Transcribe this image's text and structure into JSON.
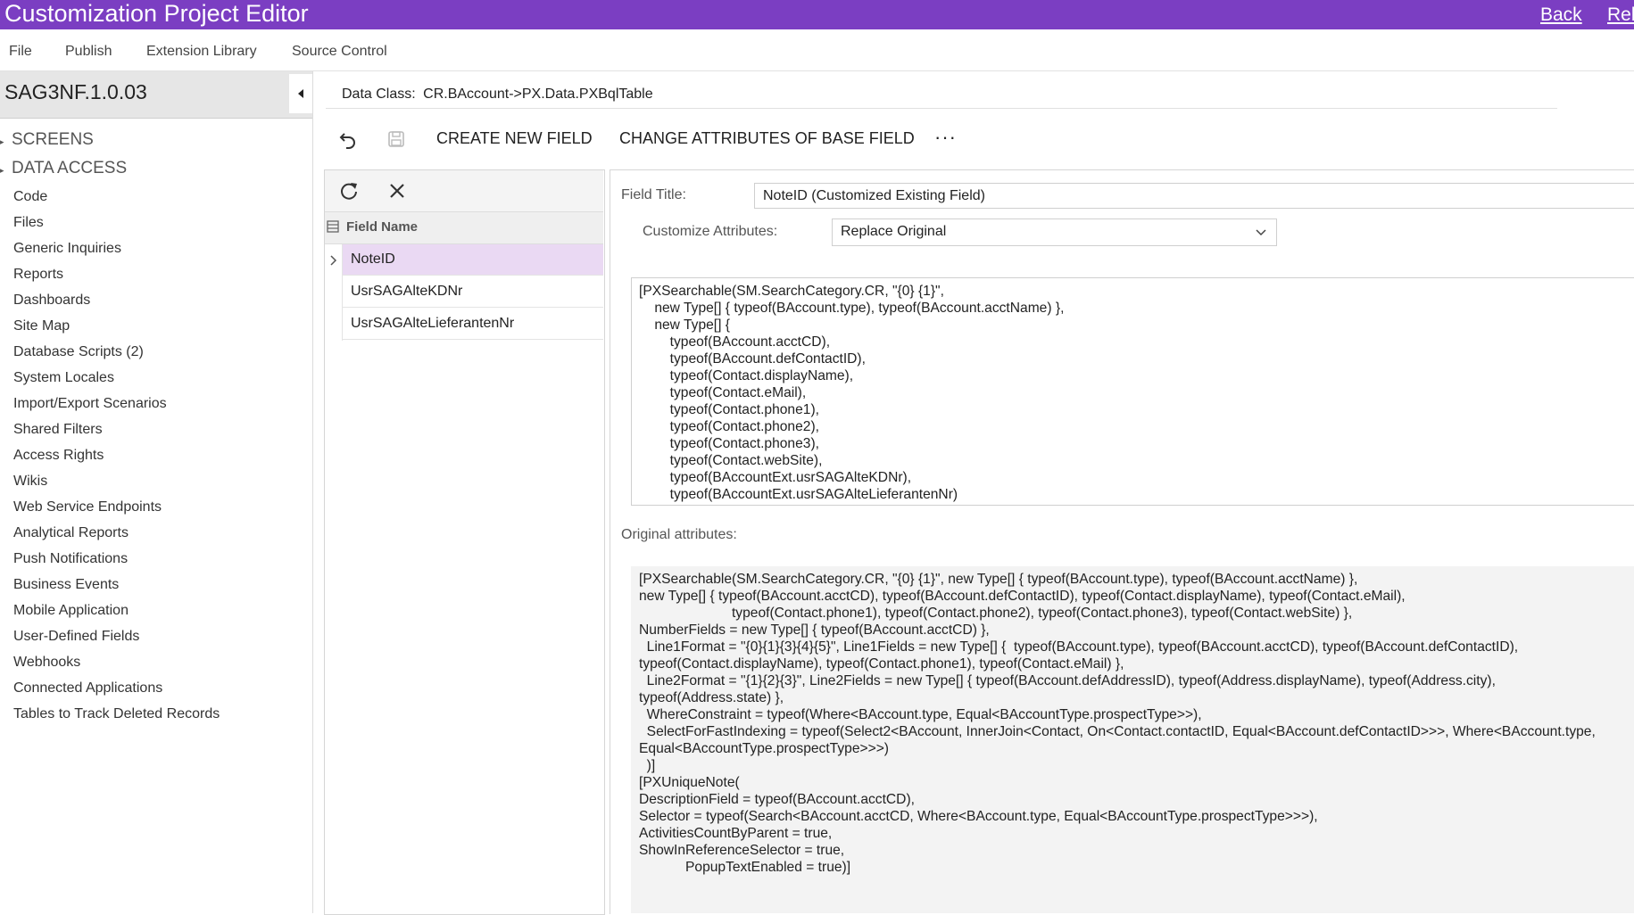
{
  "colors": {
    "accent": "#7b3ec2",
    "selected_row": "#ead9f3"
  },
  "header": {
    "title": "Customization Project Editor",
    "back_link": "Back",
    "right_link_partial": "Rel"
  },
  "menu": [
    "File",
    "Publish",
    "Extension Library",
    "Source Control"
  ],
  "sidebar": {
    "project_name": "SAG3NF.1.0.03",
    "groups": [
      "SCREENS",
      "DATA ACCESS"
    ],
    "items": [
      "Code",
      "Files",
      "Generic Inquiries",
      "Reports",
      "Dashboards",
      "Site Map",
      "Database Scripts (2)",
      "System Locales",
      "Import/Export Scenarios",
      "Shared Filters",
      "Access Rights",
      "Wikis",
      "Web Service Endpoints",
      "Analytical Reports",
      "Push Notifications",
      "Business Events",
      "Mobile Application",
      "User-Defined Fields",
      "Webhooks",
      "Connected Applications",
      "Tables to Track Deleted Records"
    ]
  },
  "main": {
    "data_class_label": "Data Class:",
    "data_class_value": "CR.BAccount->PX.Data.PXBqlTable",
    "toolbar": {
      "create_new_field": "CREATE NEW FIELD",
      "change_attributes": "CHANGE ATTRIBUTES OF BASE FIELD",
      "more": "···"
    }
  },
  "fields": {
    "column_header": "Field Name",
    "rows": [
      "NoteID",
      "UsrSAGAlteKDNr",
      "UsrSAGAlteLieferantenNr"
    ],
    "selected_index": 0
  },
  "detail": {
    "field_title_label": "Field Title:",
    "field_title_value": "NoteID (Customized Existing Field)",
    "customize_label": "Customize Attributes:",
    "customize_value": "Replace Original",
    "custom_attributes": "[PXSearchable(SM.SearchCategory.CR, \"{0} {1}\",\n    new Type[] { typeof(BAccount.type), typeof(BAccount.acctName) },\n    new Type[] {\n        typeof(BAccount.acctCD),\n        typeof(BAccount.defContactID),\n        typeof(Contact.displayName),\n        typeof(Contact.eMail),\n        typeof(Contact.phone1),\n        typeof(Contact.phone2),\n        typeof(Contact.phone3),\n        typeof(Contact.webSite),\n        typeof(BAccountExt.usrSAGAlteKDNr),\n        typeof(BAccountExt.usrSAGAlteLieferantenNr)",
    "original_label": "Original attributes:",
    "original_attributes": "[PXSearchable(SM.SearchCategory.CR, \"{0} {1}\", new Type[] { typeof(BAccount.type), typeof(BAccount.acctName) },\nnew Type[] { typeof(BAccount.acctCD), typeof(BAccount.defContactID), typeof(Contact.displayName), typeof(Contact.eMail),\n                        typeof(Contact.phone1), typeof(Contact.phone2), typeof(Contact.phone3), typeof(Contact.webSite) },\nNumberFields = new Type[] { typeof(BAccount.acctCD) },\n  Line1Format = \"{0}{1}{3}{4}{5}\", Line1Fields = new Type[] {  typeof(BAccount.type), typeof(BAccount.acctCD), typeof(BAccount.defContactID),\ntypeof(Contact.displayName), typeof(Contact.phone1), typeof(Contact.eMail) },\n  Line2Format = \"{1}{2}{3}\", Line2Fields = new Type[] { typeof(BAccount.defAddressID), typeof(Address.displayName), typeof(Address.city),\ntypeof(Address.state) },\n  WhereConstraint = typeof(Where<BAccount.type, Equal<BAccountType.prospectType>>),\n  SelectForFastIndexing = typeof(Select2<BAccount, InnerJoin<Contact, On<Contact.contactID, Equal<BAccount.defContactID>>>, Where<BAccount.type,\nEqual<BAccountType.prospectType>>>)\n  )]\n[PXUniqueNote(\nDescriptionField = typeof(BAccount.acctCD),\nSelector = typeof(Search<BAccount.acctCD, Where<BAccount.type, Equal<BAccountType.prospectType>>>),\nActivitiesCountByParent = true,\nShowInReferenceSelector = true,\n            PopupTextEnabled = true)]"
  }
}
